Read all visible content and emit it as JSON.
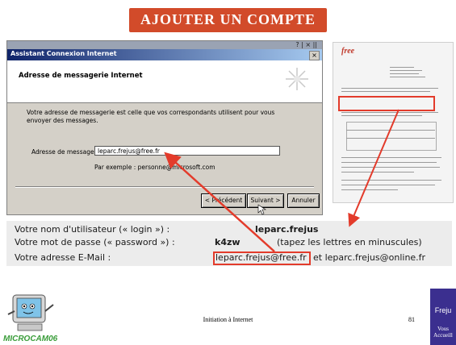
{
  "slide": {
    "title": "AJOUTER UN COMPTE",
    "footer_text": "Initiation à Internet",
    "page_number": "81",
    "brand": "MICROCAM06",
    "badge_top": "Freju",
    "badge_bottom": "Vous Accueill",
    "accent_color": "#d24b2a"
  },
  "dialog": {
    "top_right": "? | × ||",
    "window_title": "Assistant Connexion Internet",
    "close_label": "×",
    "header_title": "Adresse de messagerie Internet",
    "description": "Votre adresse de messagerie est celle que vos correspondants utilisent pour vous envoyer des messages.",
    "field_label": "Adresse de messagerie :",
    "field_value": "leparc.frejus@free.fr",
    "example": "Par exemple : personne@microsoft.com",
    "buttons": {
      "back": "< Précédent",
      "next": "Suivant >",
      "cancel": "Annuler"
    }
  },
  "document": {
    "logo": "free"
  },
  "credentials": {
    "login_label": "Votre nom d'utilisateur (« login ») :",
    "login_value": "leparc.frejus",
    "password_label": "Votre mot de passe (« password ») :",
    "password_value": "k4zw",
    "password_note": "(tapez les lettres en minuscules)",
    "email_label": "Votre adresse E-Mail :",
    "email_value": "leparc.frejus@free.fr",
    "email_alt": "et leparc.frejus@online.fr"
  }
}
